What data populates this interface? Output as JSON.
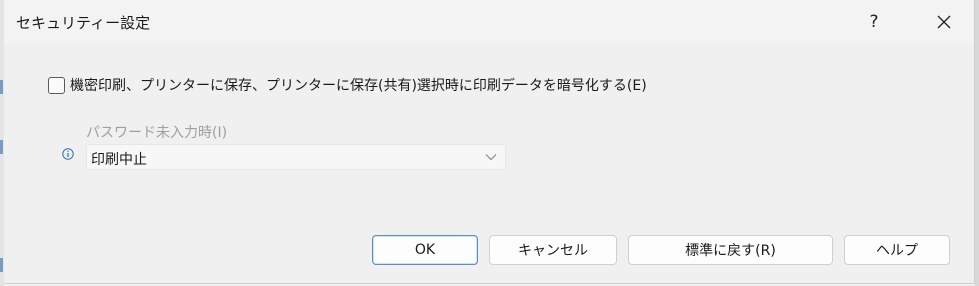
{
  "window": {
    "title": "セキュリティー設定",
    "help_label": "?"
  },
  "options": {
    "encrypt_checkbox": {
      "label": "機密印刷、プリンターに保存、プリンターに保存(共有)選択時に印刷データを暗号化する(E)",
      "checked": false
    },
    "no_password": {
      "label": "パスワード未入力時(I)",
      "enabled": false,
      "selected": "印刷中止",
      "icon": "info-icon"
    }
  },
  "buttons": {
    "ok": "OK",
    "cancel": "キャンセル",
    "reset": "標準に戻す(R)",
    "help": "ヘルプ"
  },
  "colors": {
    "accent_border": "#5b8fc9",
    "info_icon": "#2b6cb0",
    "disabled_text": "#a0a0a0"
  }
}
